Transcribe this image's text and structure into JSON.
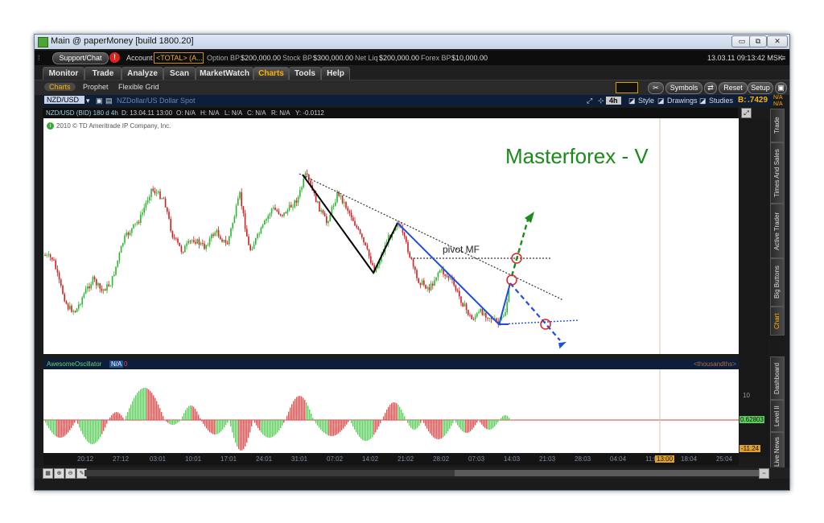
{
  "window": {
    "title": "Main @ paperMoney [build 1800.20]",
    "minimize": "▭",
    "restore": "⧉",
    "close": "✕"
  },
  "account_bar": {
    "support_label": "Support/Chat",
    "alert_badge": "!",
    "account_label": "Account",
    "account_value": "<TOTAL> (A...",
    "option_bp_label": "Option BP",
    "option_bp_value": "$200,000.00",
    "stock_bp_label": "Stock BP",
    "stock_bp_value": "$300,000.00",
    "net_liq_label": "Net Liq",
    "net_liq_value": "$200,000.00",
    "forex_bp_label": "Forex BP",
    "forex_bp_value": "$10,000.00",
    "datetime": "13.03.11 09:13:42 MSK"
  },
  "main_tabs": [
    "Monitor",
    "Trade",
    "Analyze",
    "Scan",
    "MarketWatch",
    "Charts",
    "Tools",
    "Help"
  ],
  "active_tab": "Charts",
  "sub_tabs": [
    "Charts",
    "Prophet",
    "Flexible Grid"
  ],
  "right_buttons": {
    "symbols": "Symbols",
    "reset": "Reset",
    "setup": "Setup"
  },
  "symbol_bar": {
    "symbol": "NZD/USD",
    "description": "NZDollar/US Dollar Spot",
    "timeframe": "4h",
    "style": "Style",
    "drawings": "Drawings",
    "studies": "Studies",
    "bid_label": "B:",
    "bid_value": ".7429",
    "na1": "N/A",
    "na2": "N/A"
  },
  "info_bar": {
    "series": "NZD/USD (BID) 180 d 4h",
    "date": "D: 13.04.11 13:00",
    "open": "O: N/A",
    "high": "H: N/A",
    "low": "L: N/A",
    "close": "C: N/A",
    "range": "R: N/A",
    "y": "Y: -0.0112"
  },
  "copyright": "2010 © TD Ameritrade IP Company, Inc.",
  "annotations": {
    "title": "Masterforex - V",
    "pivot": "pivot MF"
  },
  "oscillator": {
    "name": "AwesomeOscillator",
    "na": "N/A",
    "zero": "0",
    "unit": "<thousandths>",
    "level_10": "10",
    "value": "0.62803",
    "min": "-11.24"
  },
  "time_axis": [
    "20:12",
    "27:12",
    "03:01",
    "10:01",
    "17:01",
    "24:01",
    "31:01",
    "07:02",
    "14:02",
    "21:02",
    "28:02",
    "07:03",
    "14:03",
    "21:03",
    "28:03",
    "04:04",
    "11:04",
    "18:04",
    "25:04"
  ],
  "time_cursor": "13:00",
  "side_tabs": [
    "Trade",
    "Times And Sales",
    "Active Trader",
    "Big Buttons",
    "Chart",
    "Dashboard",
    "Level II",
    "Live News"
  ],
  "active_side_tab": "Chart",
  "colors": {
    "up": "#2db52d",
    "down": "#d02020",
    "ao_up": "#5ccf5c",
    "ao_down": "#e25555",
    "accent": "#ffb000",
    "title_green": "#1a8a1a",
    "blue": "#1e4fe0"
  }
}
